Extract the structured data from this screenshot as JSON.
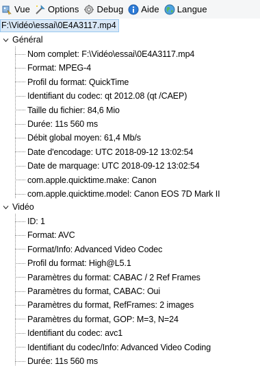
{
  "menu": [
    {
      "icon": "view-icon",
      "label": "Vue"
    },
    {
      "icon": "options-icon",
      "label": "Options"
    },
    {
      "icon": "debug-icon",
      "label": "Debug"
    },
    {
      "icon": "help-icon",
      "label": "Aide"
    },
    {
      "icon": "language-icon",
      "label": "Langue"
    }
  ],
  "file": "F:\\Vidéo\\essai\\0E4A3117.mp4",
  "sections": [
    {
      "title": "Général",
      "rows": [
        "Nom complet: F:\\Vidéo\\essai\\0E4A3117.mp4",
        "Format: MPEG-4",
        "Profil du format: QuickTime",
        "Identifiant du codec: qt   2012.08 (qt  /CAEP)",
        "Taille du fichier: 84,6 Mio",
        "Durée: 11s 560 ms",
        "Débit global moyen: 61,4 Mb/s",
        "Date d'encodage: UTC 2018-09-12 13:02:54",
        "Date de marquage: UTC 2018-09-12 13:02:54",
        "com.apple.quicktime.make: Canon",
        "com.apple.quicktime.model: Canon EOS 7D Mark II"
      ]
    },
    {
      "title": "Vidéo",
      "rows": [
        "ID: 1",
        "Format: AVC",
        "Format/Info: Advanced Video Codec",
        "Profil du format: High@L5.1",
        "Paramètres du format: CABAC / 2 Ref Frames",
        "Paramètres du format, CABAC: Oui",
        "Paramètres du format, RefFrames: 2 images",
        "Paramètres du format, GOP: M=3, N=24",
        "Identifiant du codec: avc1",
        "Identifiant du codec/Info: Advanced Video Coding",
        "Durée: 11s 560 ms"
      ]
    }
  ],
  "colors": {
    "selection": "#d9e8f7",
    "menubar": "#f5f6f7"
  }
}
